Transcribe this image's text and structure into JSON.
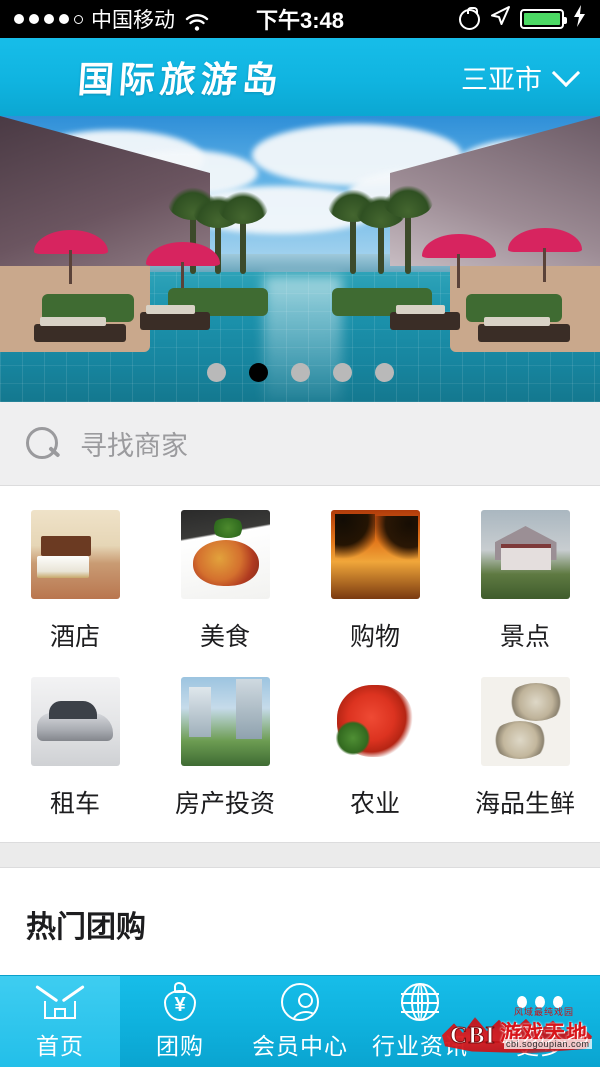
{
  "statusbar": {
    "carrier": "中国移动",
    "time": "下午3:48",
    "signal_dots_filled": 4,
    "signal_dots_total": 5,
    "wifi_icon": "wifi-icon",
    "lock_rotation_icon": "rotation-lock-icon",
    "location_icon": "location-arrow-icon",
    "battery_icon": "battery-icon",
    "battery_color": "#4cd964",
    "charging_icon": "lightning-bolt-icon"
  },
  "header": {
    "logo_text": "国际旅游岛",
    "city": "三亚市",
    "chevron_icon": "chevron-down-icon",
    "bg_color": "#12b6e4"
  },
  "banner": {
    "alt": "三亚度假村泳池",
    "dots": [
      {
        "active": false
      },
      {
        "active": true
      },
      {
        "active": false
      },
      {
        "active": false
      },
      {
        "active": false
      }
    ],
    "active_dot_color": "#000000",
    "inactive_dot_color": "#b9b9b9"
  },
  "search": {
    "icon": "search-icon",
    "placeholder": "寻找商家",
    "value": ""
  },
  "categories": [
    {
      "label": "酒店",
      "thumb": "hotel-room-photo",
      "thumb_class": "t-hotel"
    },
    {
      "label": "美食",
      "thumb": "stir-fry-dish-photo",
      "thumb_class": "t-food"
    },
    {
      "label": "购物",
      "thumb": "palm-sunset-photo",
      "thumb_class": "t-shop"
    },
    {
      "label": "景点",
      "thumb": "heritage-house-photo",
      "thumb_class": "t-scenic"
    },
    {
      "label": "租车",
      "thumb": "silver-sedan-photo",
      "thumb_class": "t-car"
    },
    {
      "label": "房产投资",
      "thumb": "residential-towers-photo",
      "thumb_class": "t-estate"
    },
    {
      "label": "农业",
      "thumb": "shrimp-platter-photo",
      "thumb_class": "t-agri"
    },
    {
      "label": "海品生鲜",
      "thumb": "baked-oysters-photo",
      "thumb_class": "t-sea"
    }
  ],
  "section": {
    "title": "热门团购"
  },
  "tabbar": {
    "items": [
      {
        "label": "首页",
        "icon": "home-icon",
        "active": true
      },
      {
        "label": "团购",
        "icon": "money-bag-icon",
        "active": false
      },
      {
        "label": "会员中心",
        "icon": "user-circle-icon",
        "active": false
      },
      {
        "label": "行业资讯",
        "icon": "globe-icon",
        "active": false
      },
      {
        "label": "更多",
        "icon": "more-dots-icon",
        "active": false
      }
    ],
    "bg_color": "#0fb2de",
    "active_bg_color": "#2ec5ec"
  },
  "watermark": {
    "brand": "CBI",
    "name": "游戏天地",
    "top_text": "风域最纯戏园",
    "bottom_text": "cbi.sogoupian.com"
  }
}
